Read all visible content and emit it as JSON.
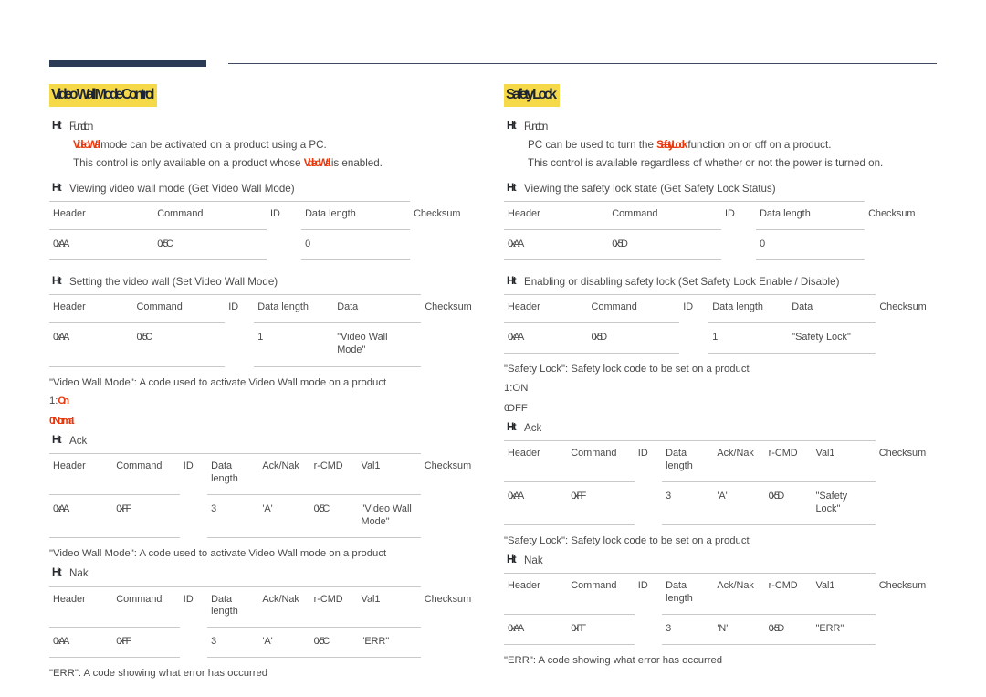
{
  "document": {
    "bullet_marker": "Ht"
  },
  "left": {
    "title": "Video Wall Mode Control",
    "function": {
      "label": "Function",
      "line1_pre": "",
      "line1_highlight": "Video Wall",
      "line1_post": " mode can be activated on a product using a PC.",
      "line2_pre": "This control is only available on a product whose ",
      "line2_highlight": "Video Wall",
      "line2_post": " is enabled."
    },
    "view_section": {
      "label": "Viewing video wall mode (Get Video Wall Mode)",
      "headers": [
        "Header",
        "Command",
        "ID",
        "Data length",
        "Checksum"
      ],
      "values": [
        "0xAA",
        "0x5C",
        "",
        "0",
        ""
      ]
    },
    "set_section": {
      "label": "Setting the video wall (Set Video Wall Mode)",
      "headers": [
        "Header",
        "Command",
        "ID",
        "Data length",
        "Data",
        "Checksum"
      ],
      "values": [
        "0xAA",
        "0x5C",
        "",
        "1",
        "\"Video Wall Mode\"",
        ""
      ]
    },
    "data_note": "\"Video Wall Mode\": A code used to activate Video Wall mode on a product",
    "data_values": [
      {
        "key": "1:",
        "value": "On"
      },
      {
        "key": "0:",
        "value": "Normal"
      }
    ],
    "ack": {
      "label": "Ack",
      "headers": [
        "Header",
        "Command",
        "ID",
        "Data length",
        "Ack/Nak",
        "r-CMD",
        "Val1",
        "Checksum"
      ],
      "values": [
        "0xAA",
        "0xFF",
        "",
        "3",
        "'A'",
        "0x5C",
        "\"Video Wall Mode\"",
        ""
      ],
      "note": "\"Video Wall Mode\": A code used to activate Video Wall mode on a product"
    },
    "nak": {
      "label": "Nak",
      "headers": [
        "Header",
        "Command",
        "ID",
        "Data length",
        "Ack/Nak",
        "r-CMD",
        "Val1",
        "Checksum"
      ],
      "values": [
        "0xAA",
        "0xFF",
        "",
        "3",
        "'A'",
        "0x5C",
        "\"ERR\"",
        ""
      ],
      "note": "\"ERR\": A code showing what error has occurred"
    }
  },
  "right": {
    "title": "Safety Lock",
    "function": {
      "label": "Function",
      "line1_pre": "PC can be used to turn the ",
      "line1_highlight": "Safety Lock",
      "line1_post": " function on or off on a product.",
      "line2": "This control is available regardless of whether or not the power is turned on."
    },
    "view_section": {
      "label": "Viewing the safety lock state (Get Safety Lock Status)",
      "headers": [
        "Header",
        "Command",
        "ID",
        "Data length",
        "Checksum"
      ],
      "values": [
        "0xAA",
        "0x5D",
        "",
        "0",
        ""
      ]
    },
    "set_section": {
      "label": "Enabling or disabling safety lock (Set Safety Lock Enable / Disable)",
      "headers": [
        "Header",
        "Command",
        "ID",
        "Data length",
        "Data",
        "Checksum"
      ],
      "values": [
        "0xAA",
        "0x5D",
        "",
        "1",
        "\"Safety Lock\"",
        " "
      ]
    },
    "data_note": "\"Safety Lock\": Safety lock code to be set on a product",
    "data_values": [
      {
        "key": "1:",
        "value": "ON"
      },
      {
        "key": "0:",
        "value": "OFF"
      }
    ],
    "ack": {
      "label": "Ack",
      "headers": [
        "Header",
        "Command",
        "ID",
        "Data length",
        "Ack/Nak",
        "r-CMD",
        "Val1",
        "Checksum"
      ],
      "values": [
        "0xAA",
        "0xFF",
        "",
        "3",
        "'A'",
        "0x5D",
        "\"Safety Lock\"",
        ""
      ],
      "note": "\"Safety Lock\": Safety lock code to be set on a product"
    },
    "nak": {
      "label": "Nak",
      "headers": [
        "Header",
        "Command",
        "ID",
        "Data length",
        "Ack/Nak",
        "r-CMD",
        "Val1",
        "Checksum"
      ],
      "values": [
        "0xAA",
        "0xFF",
        "",
        "3",
        "'N'",
        "0x5D",
        "\"ERR\"",
        ""
      ],
      "note": "\"ERR\": A code showing what error has occurred"
    }
  },
  "colors": {
    "rule_navy": "#2b3a55",
    "highlight_yellow": "#f5d949",
    "accent_red": "#e8380d"
  }
}
